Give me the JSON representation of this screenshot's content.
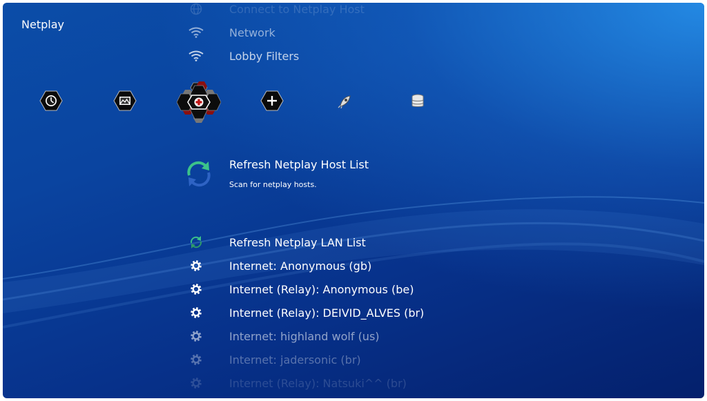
{
  "title": "Netplay",
  "menu_top": [
    {
      "label": "Connect to Netplay Host",
      "icon": "globe-icon"
    },
    {
      "label": "Network",
      "icon": "wifi-icon"
    },
    {
      "label": "Lobby Filters",
      "icon": "wifi-icon"
    }
  ],
  "tabs": [
    {
      "icon": "history-icon"
    },
    {
      "icon": "images-icon"
    },
    {
      "icon": "netplay-icon",
      "selected": true
    },
    {
      "icon": "add-icon"
    },
    {
      "icon": "explore-icon"
    },
    {
      "icon": "database-icon"
    }
  ],
  "selected_item": {
    "label": "Refresh Netplay Host List",
    "sublabel": "Scan for netplay hosts.",
    "icon": "refresh-icon"
  },
  "menu_bottom": [
    {
      "label": "Refresh Netplay LAN List",
      "icon": "refresh-icon"
    },
    {
      "label": "Internet: Anonymous (gb)",
      "icon": "gear-icon"
    },
    {
      "label": "Internet (Relay): Anonymous (be)",
      "icon": "gear-icon"
    },
    {
      "label": "Internet (Relay): DEIVID_ALVES (br)",
      "icon": "gear-icon"
    },
    {
      "label": "Internet: highland wolf (us)",
      "icon": "gear-icon"
    },
    {
      "label": "Internet: jadersonic (br)",
      "icon": "gear-icon"
    },
    {
      "label": "Internet (Relay): Natsuki^^ (br)",
      "icon": "gear-icon"
    }
  ],
  "colors": {
    "background_top": "#0b4da8",
    "background_bottom": "#04206c",
    "accent_red": "#b01818",
    "refresh_green": "#3cc28a",
    "refresh_blue": "#2e63c4"
  }
}
